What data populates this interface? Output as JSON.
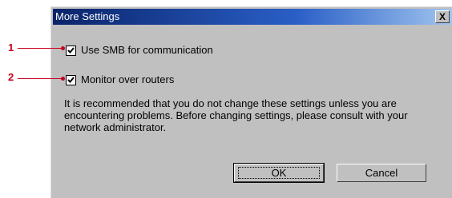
{
  "dialog": {
    "title": "More Settings",
    "close_label": "X",
    "options": [
      {
        "callout": "1",
        "label": "Use SMB for communication",
        "checked": true
      },
      {
        "callout": "2",
        "label": "Monitor over routers",
        "checked": true
      }
    ],
    "note": "It is recommended that you do not change these settings unless you are encountering problems. Before changing settings, please consult with your network administrator.",
    "ok_label": "OK",
    "cancel_label": "Cancel"
  },
  "colors": {
    "callout": "#c8001e",
    "face": "#c0c0c0",
    "title_start": "#0a246a",
    "title_end": "#a6caf0"
  }
}
